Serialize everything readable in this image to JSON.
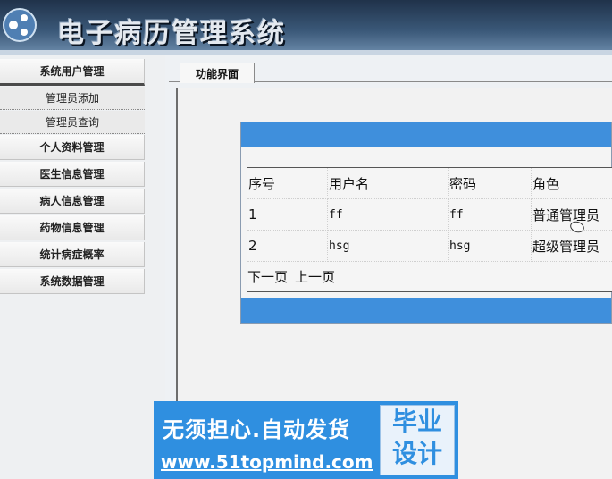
{
  "header": {
    "title": "电子病历管理系统"
  },
  "sidebar": {
    "items": [
      {
        "label": "系统用户管理"
      },
      {
        "label": "个人资料管理"
      },
      {
        "label": "医生信息管理"
      },
      {
        "label": "病人信息管理"
      },
      {
        "label": "药物信息管理"
      },
      {
        "label": "统计病症概率"
      },
      {
        "label": "系统数据管理"
      }
    ],
    "submenu": [
      {
        "label": "管理员添加"
      },
      {
        "label": "管理员查询"
      }
    ]
  },
  "main": {
    "tab_label": "功能界面",
    "table": {
      "headers": [
        "序号",
        "用户名",
        "密码",
        "角色"
      ],
      "rows": [
        [
          "1",
          "ff",
          "ff",
          "普通管理员"
        ],
        [
          "2",
          "hsg",
          "hsg",
          "超级管理员"
        ]
      ]
    },
    "pager": {
      "next": "下一页",
      "prev": "上一页"
    }
  },
  "watermark": {
    "line1": "无须担心.自动发货",
    "line2": "www.51topmind.com",
    "box_line1": "毕业",
    "box_line2": "设计"
  },
  "colors": {
    "accent": "#3f8fdc",
    "header_dark": "#20324a",
    "watermark": "#2f8fe0"
  }
}
